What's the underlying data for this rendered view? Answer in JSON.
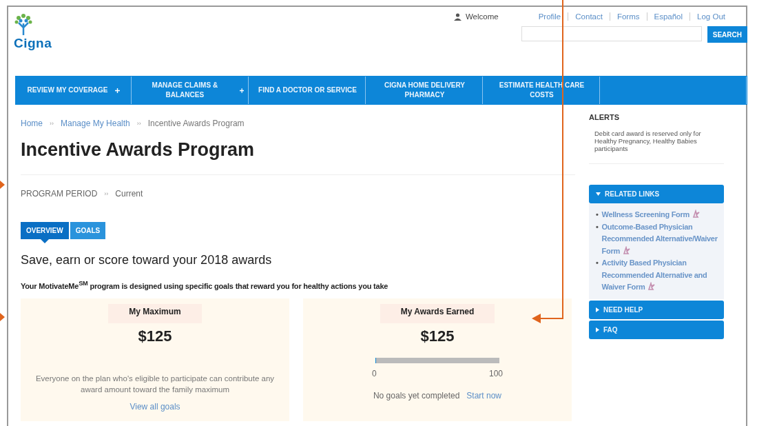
{
  "header": {
    "logo": "Cigna",
    "welcome": "Welcome",
    "links": [
      "Profile",
      "Contact",
      "Forms",
      "Español",
      "Log Out"
    ],
    "search_button": "SEARCH"
  },
  "nav": [
    {
      "label": "REVIEW MY COVERAGE",
      "has_menu": true
    },
    {
      "label": "MANAGE CLAIMS & BALANCES",
      "has_menu": true
    },
    {
      "label": "FIND A DOCTOR OR SERVICE",
      "has_menu": false
    },
    {
      "label": "CIGNA HOME DELIVERY PHARMACY",
      "has_menu": false
    },
    {
      "label": "ESTIMATE HEALTH CARE COSTS",
      "has_menu": false
    }
  ],
  "breadcrumb": [
    "Home",
    "Manage My Health",
    "Incentive Awards Program"
  ],
  "separator": "››",
  "bullet": "•",
  "title": "Incentive Awards Program",
  "program_period": {
    "label": "PROGRAM PERIOD",
    "value": "Current"
  },
  "tabs": [
    {
      "label": "OVERVIEW",
      "selected": true
    },
    {
      "label": "GOALS",
      "selected": false
    }
  ],
  "heading": "Save, earn or score toward your 2018 awards",
  "intro": "Your MotivateMe$^{SM}$ program is designed using specific goals that reward you for healthy actions you take",
  "maximum_card": {
    "title": "My Maximum",
    "amount": "$125",
    "note": "Everyone on the plan who's eligible to participate can contribute any award amount toward the family maximum",
    "link": "View all goals"
  },
  "awards_card": {
    "title": "My Awards Earned",
    "amount": "$125",
    "level": 0,
    "min_label": "0",
    "max_label": "100",
    "status": "No goals yet completed",
    "link": "Start now"
  },
  "sidebar": {
    "alerts_title": "ALERTS",
    "alert": "Debit card award is reserved only for Healthy Pregnancy, Healthy Babies participants",
    "sections": [
      {
        "title": "RELATED LINKS",
        "expanded": true,
        "links": [
          "Wellness Screening Form",
          "Outcome-Based Physician Recommended Alternative/Waiver Form",
          "Activity Based Physician Recommended Alternative and Waiver Form"
        ]
      },
      {
        "title": "NEED HELP",
        "expanded": false
      },
      {
        "title": "FAQ",
        "expanded": false
      }
    ]
  }
}
